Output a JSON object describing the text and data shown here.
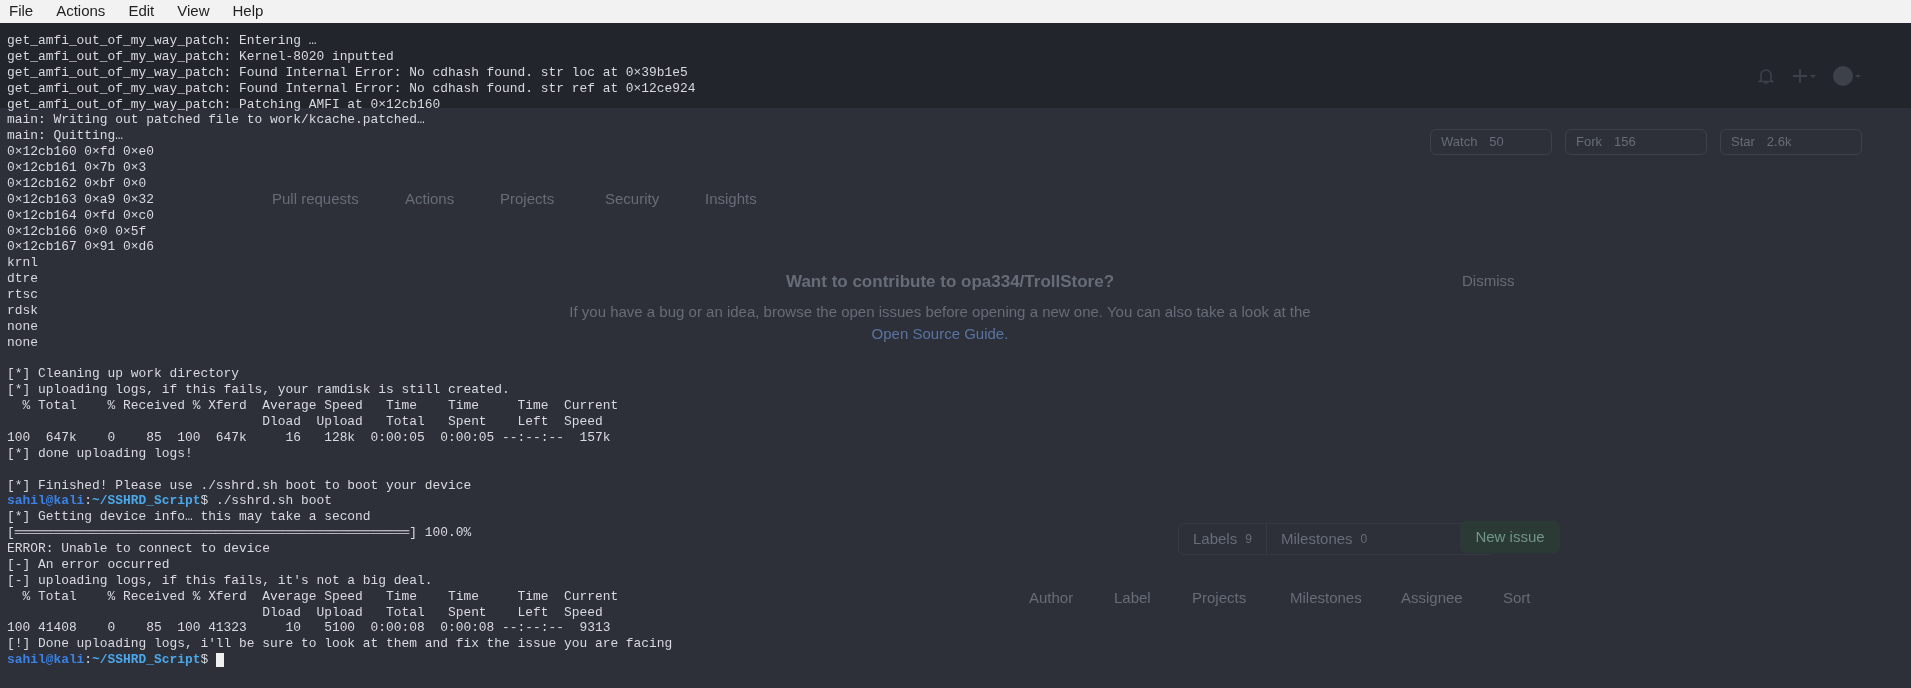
{
  "menu": [
    "File",
    "Actions",
    "Edit",
    "View",
    "Help"
  ],
  "terminal": {
    "lines": [
      {
        "kind": "text",
        "text": "get_amfi_out_of_my_way_patch: Entering …"
      },
      {
        "kind": "text",
        "text": "get_amfi_out_of_my_way_patch: Kernel-8020 inputted"
      },
      {
        "kind": "text",
        "text": "get_amfi_out_of_my_way_patch: Found Internal Error: No cdhash found. str loc at 0×39b1e5"
      },
      {
        "kind": "text",
        "text": "get_amfi_out_of_my_way_patch: Found Internal Error: No cdhash found. str ref at 0×12ce924"
      },
      {
        "kind": "text",
        "text": "get_amfi_out_of_my_way_patch: Patching AMFI at 0×12cb160"
      },
      {
        "kind": "text",
        "text": "main: Writing out patched file to work/kcache.patched…"
      },
      {
        "kind": "text",
        "text": "main: Quitting…"
      },
      {
        "kind": "text",
        "text": "0×12cb160 0×fd 0×e0"
      },
      {
        "kind": "text",
        "text": "0×12cb161 0×7b 0×3"
      },
      {
        "kind": "text",
        "text": "0×12cb162 0×bf 0×0"
      },
      {
        "kind": "text",
        "text": "0×12cb163 0×a9 0×32"
      },
      {
        "kind": "text",
        "text": "0×12cb164 0×fd 0×c0"
      },
      {
        "kind": "text",
        "text": "0×12cb166 0×0 0×5f"
      },
      {
        "kind": "text",
        "text": "0×12cb167 0×91 0×d6"
      },
      {
        "kind": "text",
        "text": "krnl"
      },
      {
        "kind": "text",
        "text": "dtre"
      },
      {
        "kind": "text",
        "text": "rtsc"
      },
      {
        "kind": "text",
        "text": "rdsk"
      },
      {
        "kind": "text",
        "text": "none"
      },
      {
        "kind": "text",
        "text": "none"
      },
      {
        "kind": "blank"
      },
      {
        "kind": "text",
        "text": "[*] Cleaning up work directory"
      },
      {
        "kind": "text",
        "text": "[*] uploading logs, if this fails, your ramdisk is still created."
      },
      {
        "kind": "text",
        "text": "  % Total    % Received % Xferd  Average Speed   Time    Time     Time  Current"
      },
      {
        "kind": "text",
        "text": "                                 Dload  Upload   Total   Spent    Left  Speed"
      },
      {
        "kind": "text",
        "text": "100  647k    0    85  100  647k     16   128k  0:00:05  0:00:05 --:--:--  157k"
      },
      {
        "kind": "text",
        "text": "[*] done uploading logs!"
      },
      {
        "kind": "blank"
      },
      {
        "kind": "text",
        "text": "[*] Finished! Please use ./sshrd.sh boot to boot your device"
      },
      {
        "kind": "prompt",
        "user": "sahil@kali",
        "sep": ":",
        "path": "~/SSHRD_Script",
        "command": "$ ./sshrd.sh boot",
        "cursor": false
      },
      {
        "kind": "text",
        "text": "[*] Getting device info… this may take a second"
      },
      {
        "kind": "text",
        "text": "[═══════════════════════════════════════════════════] 100.0%"
      },
      {
        "kind": "text",
        "text": "ERROR: Unable to connect to device"
      },
      {
        "kind": "text",
        "text": "[-] An error occurred"
      },
      {
        "kind": "text",
        "text": "[-] uploading logs, if this fails, it's not a big deal."
      },
      {
        "kind": "text",
        "text": "  % Total    % Received % Xferd  Average Speed   Time    Time     Time  Current"
      },
      {
        "kind": "text",
        "text": "                                 Dload  Upload   Total   Spent    Left  Speed"
      },
      {
        "kind": "text",
        "text": "100 41408    0    85  100 41323     10   5100  0:00:08  0:00:08 --:--:--  9313"
      },
      {
        "kind": "text",
        "text": "[!] Done uploading logs, i'll be sure to look at them and fix the issue you are facing"
      },
      {
        "kind": "prompt",
        "user": "sahil@kali",
        "sep": ":",
        "path": "~/SSHRD_Script",
        "command": "$ ",
        "cursor": true
      }
    ]
  },
  "background_page": {
    "tabs": [
      "Pull requests",
      "Actions",
      "Projects",
      "Security",
      "Insights"
    ],
    "repo_buttons": [
      {
        "label": "Watch",
        "count": "50"
      },
      {
        "label": "Fork",
        "count": "156"
      },
      {
        "label": "Star",
        "count": "2.6k"
      }
    ],
    "banner": {
      "title": "Want to contribute to opa334/TrollStore?",
      "text": "If you have a bug or an idea, browse the open issues before opening a new one. You can also take a look at the",
      "link": "Open Source Guide.",
      "dismiss": "Dismiss"
    },
    "labels": {
      "label": "Labels",
      "count": "9"
    },
    "milestones": {
      "label": "Milestones",
      "count": "0"
    },
    "new_issue": "New issue",
    "filters": [
      "Author",
      "Label",
      "Projects",
      "Milestones",
      "Assignee",
      "Sort"
    ]
  }
}
